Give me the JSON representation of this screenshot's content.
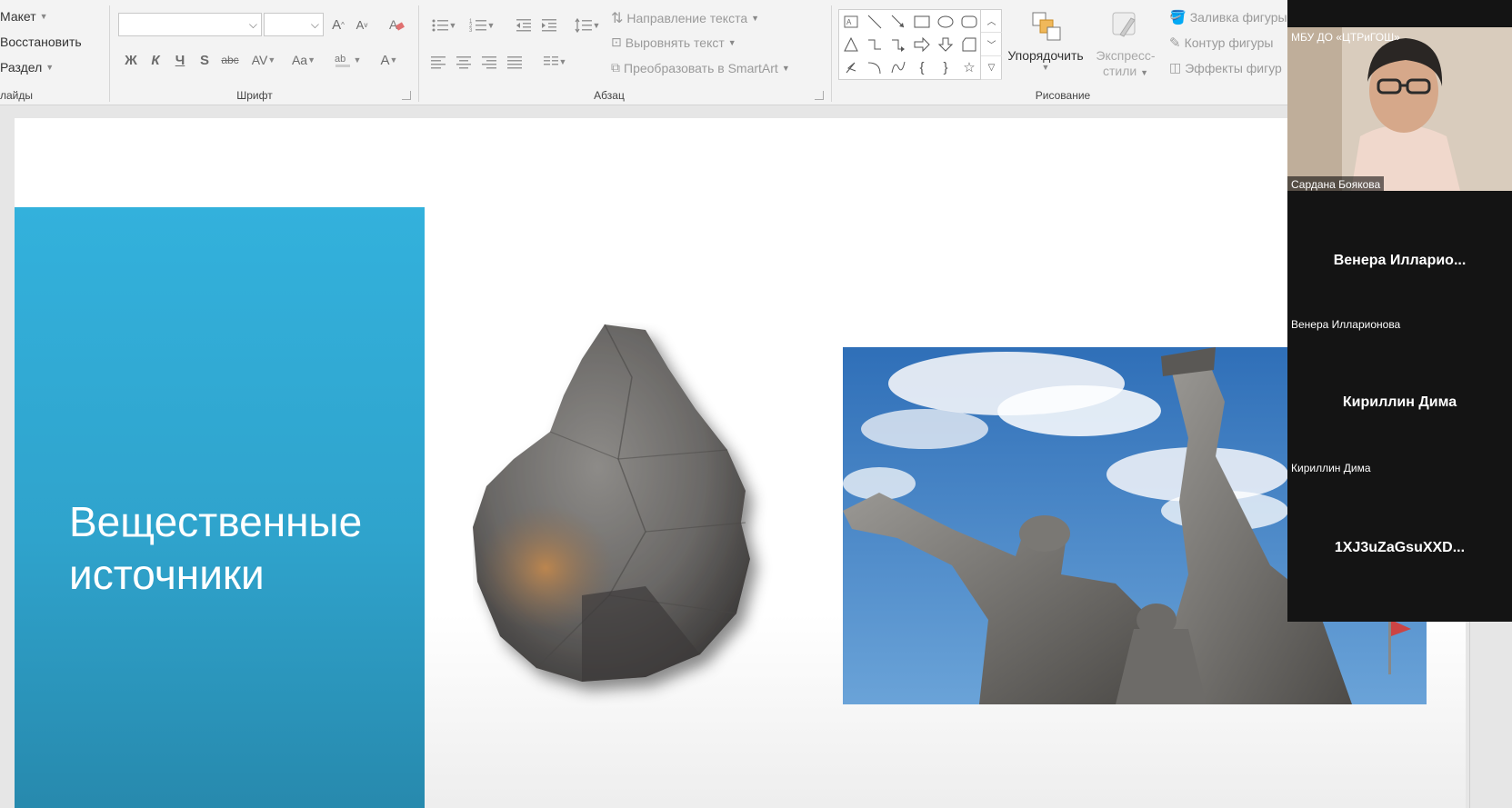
{
  "ribbon": {
    "slides_group": {
      "layout": "Макет",
      "reset": "Восстановить",
      "section": "Раздел",
      "label": "лайды"
    },
    "font_group": {
      "label": "Шрифт",
      "font_name": "",
      "font_size": "",
      "grow": "A",
      "shrink": "A",
      "bold": "Ж",
      "italic": "К",
      "underline": "Ч",
      "shadow": "S",
      "strike": "abc",
      "spacing": "AV",
      "case": "Aa",
      "font_color": "A"
    },
    "paragraph_group": {
      "label": "Абзац",
      "text_direction": "Направление текста",
      "align_text": "Выровнять текст",
      "smartart": "Преобразовать в SmartArt"
    },
    "drawing_group": {
      "label": "Рисование",
      "arrange": "Упорядочить",
      "quick_styles_1": "Экспресс-",
      "quick_styles_2": "стили",
      "shape_fill": "Заливка фигуры",
      "shape_outline": "Контур фигуры",
      "shape_effects": "Эффекты фигур"
    }
  },
  "slide": {
    "title_line1": "Вещественные",
    "title_line2": "источники",
    "accent_color": "#33b1dc"
  },
  "video": {
    "tiles": [
      {
        "top_label": "МБУ ДО «ЦТРиГОШ»",
        "name": "Сардана Боякова"
      },
      {
        "big_name": "Венера  Илларио...",
        "name": "Венера Илларионова"
      },
      {
        "big_name": "Кириллин Дима",
        "name": "Кириллин Дима"
      },
      {
        "big_name": "1XJ3uZaGsuXXD..."
      }
    ]
  }
}
